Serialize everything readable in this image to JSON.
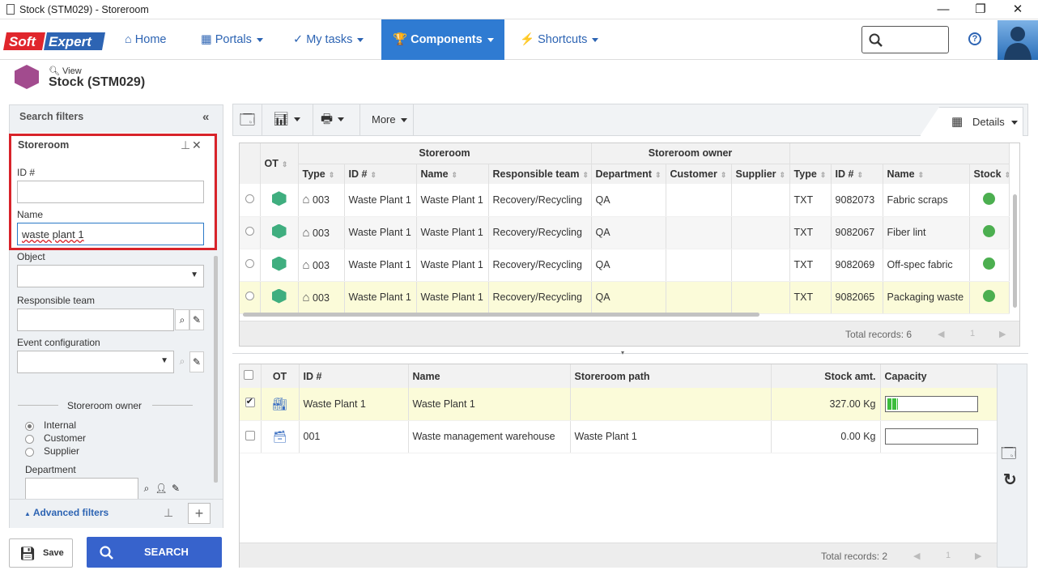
{
  "window": {
    "title": "Stock (STM029) - Storeroom",
    "min": "—",
    "max": "❐",
    "close": "✕"
  },
  "nav": {
    "logo_soft": "Soft",
    "logo_expert": "Expert",
    "items": [
      {
        "label": "Home",
        "icon": "home-icon"
      },
      {
        "label": "Portals",
        "icon": "grid-icon"
      },
      {
        "label": "My tasks",
        "icon": "check-icon"
      },
      {
        "label": "Components",
        "icon": "trophy-icon",
        "active": true
      },
      {
        "label": "Shortcuts",
        "icon": "bolt-icon"
      }
    ],
    "search_placeholder": "",
    "help": "?"
  },
  "page": {
    "view_label": "View",
    "title": "Stock (STM029)"
  },
  "filters": {
    "header": "Search filters",
    "collapse": "«",
    "section": "Storeroom",
    "id_label": "ID #",
    "id_value": "",
    "name_label": "Name",
    "name_value": "waste plant 1",
    "object_label": "Object",
    "object_value": "",
    "team_label": "Responsible team",
    "team_value": "",
    "event_label": "Event configuration",
    "event_value": "",
    "owner_label": "Storeroom owner",
    "owner_options": [
      "Internal",
      "Customer",
      "Supplier"
    ],
    "owner_selected": "Internal",
    "dept_label": "Department",
    "dept_value": "",
    "advanced": "Advanced filters",
    "save": "Save",
    "search": "SEARCH"
  },
  "toolbar": {
    "more": "More",
    "details": "Details"
  },
  "grid1": {
    "group_headers": [
      "OT",
      "Storeroom",
      "Storeroom owner"
    ],
    "columns": [
      "Type",
      "ID #",
      "Name",
      "Responsible team",
      "Department",
      "Customer",
      "Supplier",
      "Type",
      "ID #",
      "Name",
      "Stock"
    ],
    "rows": [
      {
        "stype": "003",
        "sid": "Waste Plant 1",
        "sname": "Waste Plant 1",
        "team": "Recovery/Recycling",
        "dept": "QA",
        "customer": "",
        "supplier": "",
        "type": "TXT",
        "id": "9082073",
        "name": "Fabric scraps",
        "stock": "green"
      },
      {
        "stype": "003",
        "sid": "Waste Plant 1",
        "sname": "Waste Plant 1",
        "team": "Recovery/Recycling",
        "dept": "QA",
        "customer": "",
        "supplier": "",
        "type": "TXT",
        "id": "9082067",
        "name": "Fiber lint",
        "stock": "green"
      },
      {
        "stype": "003",
        "sid": "Waste Plant 1",
        "sname": "Waste Plant 1",
        "team": "Recovery/Recycling",
        "dept": "QA",
        "customer": "",
        "supplier": "",
        "type": "TXT",
        "id": "9082069",
        "name": "Off-spec fabric",
        "stock": "green"
      },
      {
        "stype": "003",
        "sid": "Waste Plant 1",
        "sname": "Waste Plant 1",
        "team": "Recovery/Recycling",
        "dept": "QA",
        "customer": "",
        "supplier": "",
        "type": "TXT",
        "id": "9082065",
        "name": "Packaging waste",
        "stock": "green",
        "selected": true
      }
    ],
    "total": "Total records: 6",
    "page": "1"
  },
  "grid2": {
    "columns": [
      "OT",
      "ID #",
      "Name",
      "Storeroom path",
      "Stock amt.",
      "Capacity"
    ],
    "rows": [
      {
        "id": "Waste Plant 1",
        "name": "Waste Plant 1",
        "path": "",
        "amt": "327.00 Kg",
        "capacity": 0.12,
        "checked": true
      },
      {
        "id": "001",
        "name": "Waste management warehouse",
        "path": "Waste Plant 1",
        "amt": "0.00 Kg",
        "capacity": 0,
        "checked": false
      }
    ],
    "total": "Total records: 2",
    "page": "1"
  }
}
